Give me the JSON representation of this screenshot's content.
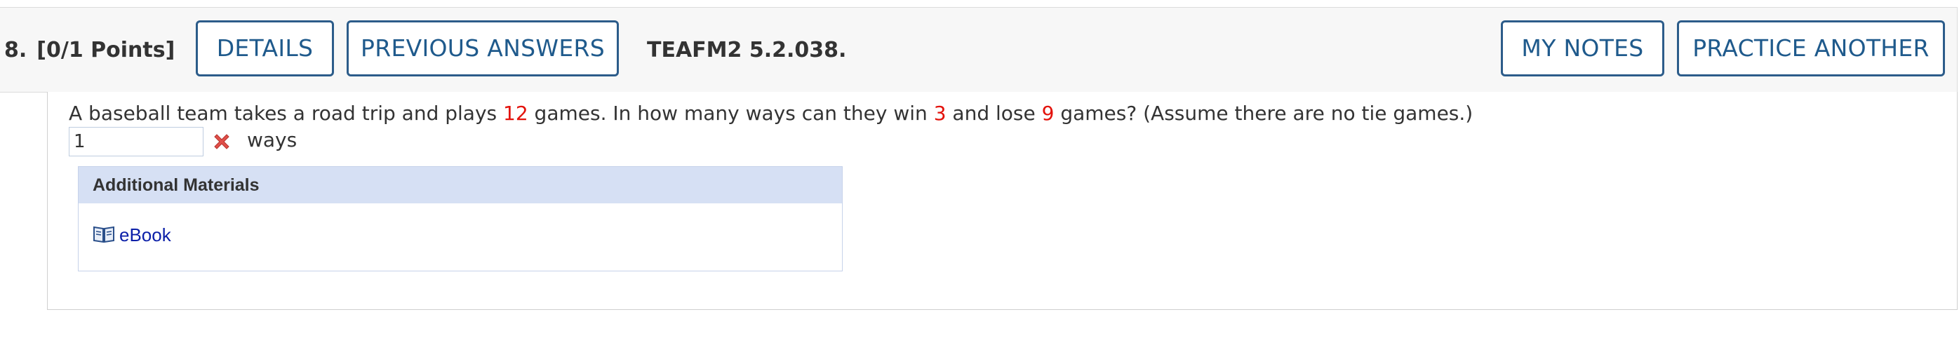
{
  "header": {
    "question_number": "8.",
    "points": "[0/1 Points]",
    "details_label": "DETAILS",
    "previous_answers_label": "PREVIOUS ANSWERS",
    "assignment_code": "TEAFM2 5.2.038.",
    "my_notes_label": "MY NOTES",
    "practice_another_label": "PRACTICE ANOTHER"
  },
  "question": {
    "text_1": "A baseball team takes a road trip and plays ",
    "games_total": "12",
    "text_2": " games. In how many ways can they win ",
    "wins": "3",
    "text_3": " and lose ",
    "losses": "9",
    "text_4": " games? (Assume there are no tie games.)",
    "highlight_color": "#e3120b"
  },
  "answer": {
    "value": "1",
    "status_icon": "incorrect-x-icon",
    "unit": "ways"
  },
  "additional_materials": {
    "title": "Additional Materials",
    "items": [
      {
        "label": "eBook",
        "icon": "book-icon"
      }
    ]
  }
}
